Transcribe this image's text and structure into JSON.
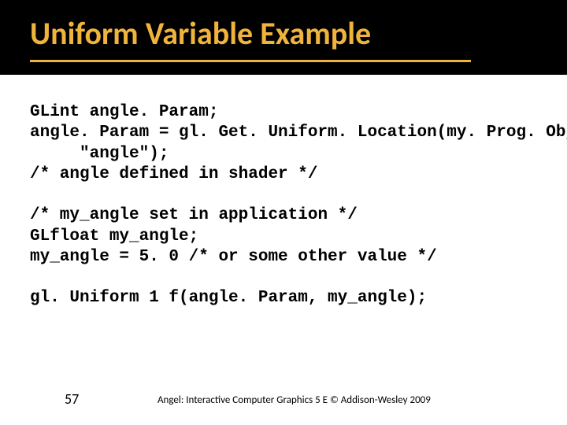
{
  "slide": {
    "title": "Uniform Variable Example",
    "code": "GLint angle. Param;\nangle. Param = gl. Get. Uniform. Location(my. Prog. Obj,\n     \"angle\");\n/* angle defined in shader */\n\n/* my_angle set in application */\nGLfloat my_angle;\nmy_angle = 5. 0 /* or some other value */\n\ngl. Uniform 1 f(angle. Param, my_angle);",
    "page_number": "57",
    "footer": "Angel: Interactive Computer Graphics 5 E © Addison-Wesley 2009"
  }
}
